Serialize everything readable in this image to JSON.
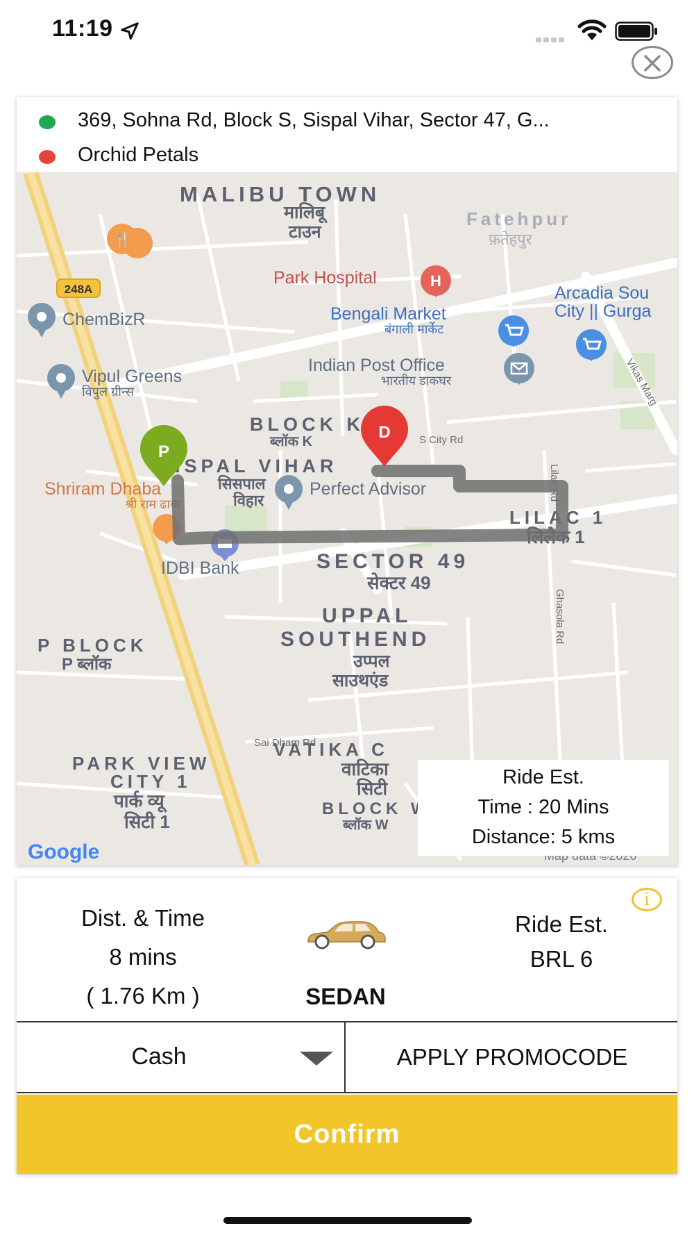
{
  "status_bar": {
    "time": "11:19"
  },
  "route": {
    "pickup_address": "369, Sohna Rd, Block S, Sispal Vihar, Sector 47, G...",
    "drop_address": "Orchid Petals",
    "pickup_color": "#1fa84f",
    "drop_color": "#e8433a"
  },
  "map": {
    "labels": {
      "malibu_town": "MALIBU TOWN",
      "malibu_hindi_1": "मालिबू",
      "malibu_hindi_2": "टाउन",
      "fatehpur": "Fatehpur",
      "fatehpur_hindi": "फ़तेहपुर",
      "park_hospital": "Park Hospital",
      "route_248a": "248A",
      "arcadia_1": "Arcadia Sou",
      "arcadia_2": "City || Gurga",
      "bengali_market": "Bengali Market",
      "bengali_market_hindi": "बंगाली मार्केट",
      "chembizr": "ChemBizR",
      "indian_post": "Indian Post Office",
      "indian_post_hindi": "भारतीय डाकघर",
      "vikas_marg": "Vikas Marg",
      "vipul_greens": "Vipul Greens",
      "vipul_greens_hindi": "विपुल ग्रीन्स",
      "block_k": "BLOCK K",
      "block_k_hindi": "ब्लॉक K",
      "s_city_rd": "S City Rd",
      "sispal_vihar": "SISPAL VIHAR",
      "sispal_hindi_1": "सिसपाल",
      "sispal_hindi_2": "विहार",
      "lilac_rd": "Lilac Rd",
      "lilac_1": "LILAC 1",
      "lilac_1_hindi": "लिलैक 1",
      "shriram_dhaba": "Shriram Dhaba",
      "shriram_dhaba_hindi": "श्री राम ढाबा",
      "perfect_advisor": "Perfect Advisor",
      "sector_49": "SECTOR 49",
      "sector_49_hindi": "सेक्टर 49",
      "idbi_bank": "IDBI Bank",
      "uppal": "UPPAL",
      "southend": "SOUTHEND",
      "uppal_hindi_1": "उप्पल",
      "uppal_hindi_2": "साउथएंड",
      "ghasola_rd": "Ghasola Rd",
      "p_block": "P BLOCK",
      "p_block_hindi": "P ब्लॉक",
      "sai_dham_rd": "Sai Dham Rd",
      "park_view_1": "PARK VIEW",
      "park_view_2": "CITY 1",
      "park_view_hindi_1": "पार्क व्यू",
      "park_view_hindi_2": "सिटी 1",
      "vatika": "VATIKA C",
      "vatika_hindi_1": "वाटिका",
      "vatika_hindi_2": "सिटी",
      "block_w": "BLOCK W",
      "block_w_hindi": "ब्लॉक W",
      "map_data": "Map data ©2020",
      "google": "Google"
    },
    "pickup_pin": "P",
    "drop_pin": "D",
    "pin_p_color": "#7cab1f",
    "pin_d_color": "#e53935",
    "route_color": "#707070"
  },
  "ride_estimate": {
    "title": "Ride Est.",
    "time": "Time : 20 Mins",
    "distance": "Distance: 5 kms"
  },
  "booking": {
    "dist_time_label": "Dist. & Time",
    "duration": "8 mins",
    "distance": "( 1.76 Km )",
    "vehicle_type": "SEDAN",
    "fare_label": "Ride Est.",
    "fare_value": "BRL 6",
    "info_icon": "i",
    "payment_method": "Cash",
    "promo_label": "APPLY PROMOCODE",
    "confirm_label": "Confirm",
    "accent_color": "#f2c52b"
  }
}
